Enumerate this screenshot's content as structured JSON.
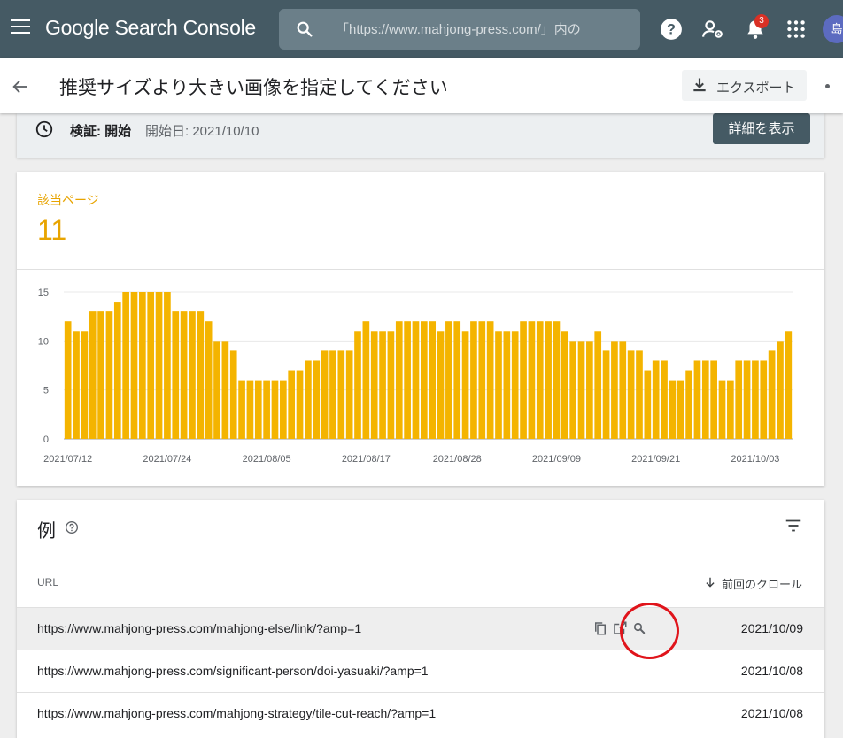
{
  "app": {
    "brand": "Google Search Console",
    "search_placeholder": "「https://www.mahjong-press.com/」内の",
    "notification_count": "3",
    "avatar_initial": "島"
  },
  "header": {
    "title": "推奨サイズより大きい画像を指定してください",
    "export_label": "エクスポート"
  },
  "validation": {
    "label": "検証: 開始",
    "start_date": "開始日: 2021/10/10",
    "details_button": "詳細を表示"
  },
  "metric": {
    "label": "該当ページ",
    "value": "11"
  },
  "chart_data": {
    "type": "bar",
    "ylim": [
      0,
      15
    ],
    "yticks": [
      0,
      5,
      10,
      15
    ],
    "grid": true,
    "x_tick_labels": [
      "2021/07/12",
      "2021/07/24",
      "2021/08/05",
      "2021/08/17",
      "2021/08/28",
      "2021/09/09",
      "2021/09/21",
      "2021/10/03"
    ],
    "x_tick_dates": [
      "2021-07-12",
      "2021-07-24",
      "2021-08-05",
      "2021-08-17",
      "2021-08-28",
      "2021-09-09",
      "2021-09-21",
      "2021-10-03"
    ],
    "x_start": "2021-07-12",
    "x_end": "2021-10-09",
    "values": [
      12,
      11,
      11,
      13,
      13,
      13,
      14,
      15,
      15,
      15,
      15,
      15,
      15,
      13,
      13,
      13,
      13,
      12,
      10,
      10,
      9,
      6,
      6,
      6,
      6,
      6,
      6,
      7,
      7,
      8,
      8,
      9,
      9,
      9,
      9,
      11,
      12,
      11,
      11,
      11,
      12,
      12,
      12,
      12,
      12,
      11,
      12,
      12,
      11,
      12,
      12,
      12,
      11,
      11,
      11,
      12,
      12,
      12,
      12,
      12,
      11,
      10,
      10,
      10,
      11,
      9,
      10,
      10,
      9,
      9,
      7,
      8,
      8,
      6,
      6,
      7,
      8,
      8,
      8,
      6,
      6,
      8,
      8,
      8,
      8,
      9,
      10,
      11
    ],
    "color": "#f4b400"
  },
  "examples": {
    "title": "例",
    "column_url": "URL",
    "column_crawl": "前回のクロール",
    "rows": [
      {
        "url": "https://www.mahjong-press.com/mahjong-else/link/?amp=1",
        "date": "2021/10/09"
      },
      {
        "url": "https://www.mahjong-press.com/significant-person/doi-yasuaki/?amp=1",
        "date": "2021/10/08"
      },
      {
        "url": "https://www.mahjong-press.com/mahjong-strategy/tile-cut-reach/?amp=1",
        "date": "2021/10/08"
      }
    ]
  }
}
